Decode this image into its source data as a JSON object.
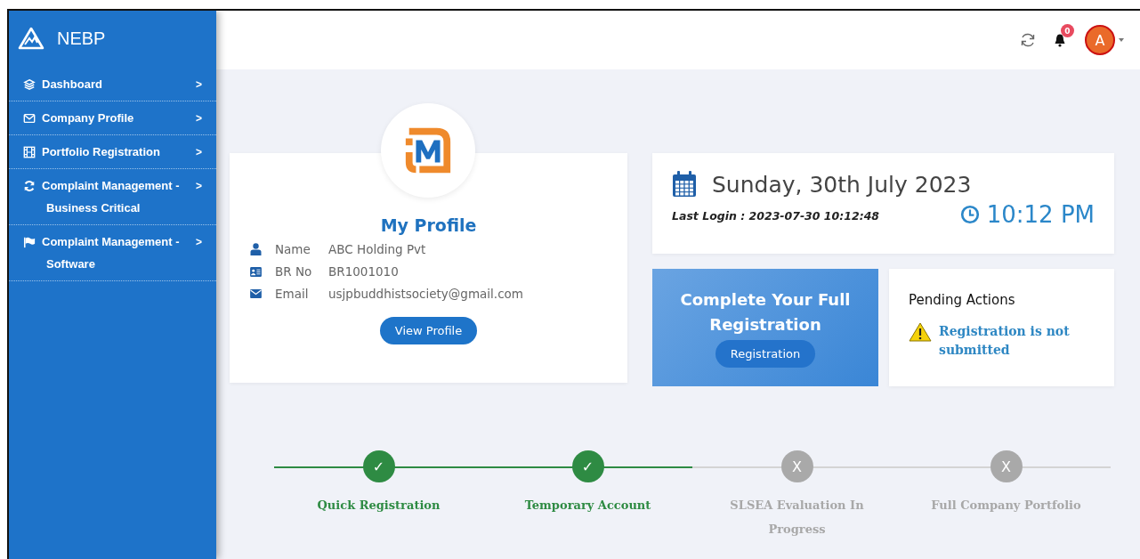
{
  "brand": {
    "name": "NEBP"
  },
  "sidebar": {
    "items": [
      {
        "label": "Dashboard",
        "arrow": ">"
      },
      {
        "label": "Company Profile",
        "arrow": ">"
      },
      {
        "label": "Portfolio Registration",
        "arrow": ">"
      },
      {
        "label": "Complaint Management -",
        "sublabel": "Business Critical",
        "arrow": ">"
      },
      {
        "label": "Complaint Management -",
        "sublabel": "Software",
        "arrow": ">"
      }
    ]
  },
  "topbar": {
    "notification_count": "0",
    "avatar_letter": "A"
  },
  "profile": {
    "title": "My Profile",
    "fields": [
      {
        "label": "Name",
        "value": "ABC Holding Pvt"
      },
      {
        "label": "BR No",
        "value": "BR1001010"
      },
      {
        "label": "Email",
        "value": "usjpbuddhistsociety@gmail.com"
      }
    ],
    "button": "View Profile"
  },
  "date_card": {
    "date": "Sunday, 30th July 2023",
    "last_login": "Last Login : 2023-07-30 10:12:48",
    "time": "10:12 PM"
  },
  "registration_card": {
    "title": "Complete Your Full Registration",
    "button": "Registration"
  },
  "pending": {
    "title": "Pending Actions",
    "items": [
      "Registration is not submitted"
    ]
  },
  "steps": [
    {
      "symbol": "✓",
      "label": "Quick Registration",
      "completed": true
    },
    {
      "symbol": "✓",
      "label": "Temporary Account",
      "completed": true
    },
    {
      "symbol": "X",
      "label": "SLSEA Evaluation In Progress",
      "completed": false
    },
    {
      "symbol": "X",
      "label": "Full Company Portfolio",
      "completed": false
    }
  ]
}
